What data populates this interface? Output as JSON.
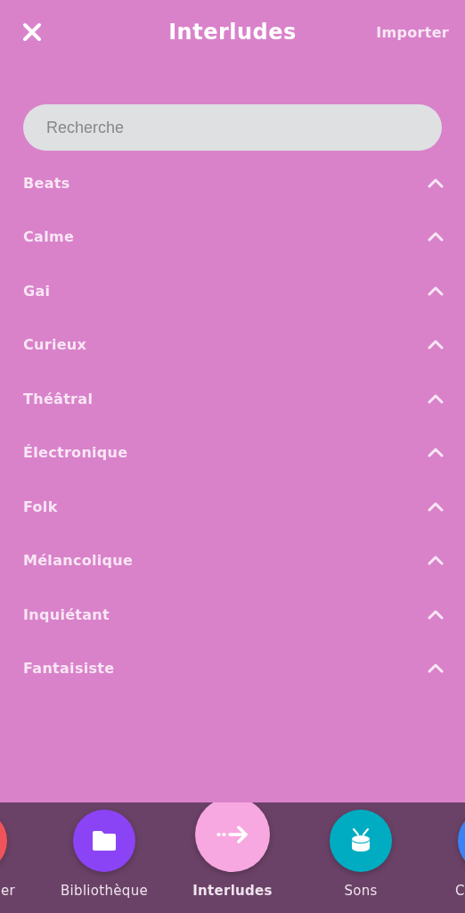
{
  "header": {
    "title": "Interludes",
    "action": "Importer"
  },
  "search": {
    "placeholder": "Recherche"
  },
  "categories": [
    {
      "label": "Beats",
      "expanded": false
    },
    {
      "label": "Calme",
      "expanded": false
    },
    {
      "label": "Gai",
      "expanded": false
    },
    {
      "label": "Curieux",
      "expanded": false
    },
    {
      "label": "Théâtral",
      "expanded": false
    },
    {
      "label": "Électronique",
      "expanded": false
    },
    {
      "label": "Folk",
      "expanded": false
    },
    {
      "label": "Mélancolique",
      "expanded": false
    },
    {
      "label": "Inquiétant",
      "expanded": false
    },
    {
      "label": "Fantaisiste",
      "expanded": false
    }
  ],
  "bottom_nav": [
    {
      "label": "er",
      "color": "#f0545a",
      "selected": false
    },
    {
      "label": "Bibliothèque",
      "kind": "folder",
      "color": "#8b44f5",
      "selected": false
    },
    {
      "label": "Interludes",
      "kind": "arrow",
      "color": "#f7a8e0",
      "selected": true
    },
    {
      "label": "Sons",
      "kind": "drum",
      "color": "#00acc1",
      "selected": false
    },
    {
      "label": "C",
      "color": "#3b82f6",
      "selected": false
    }
  ]
}
